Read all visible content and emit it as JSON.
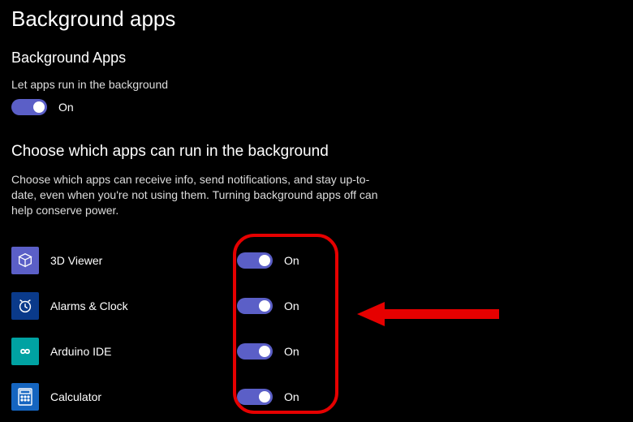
{
  "colors": {
    "accent": "#5b5fc7",
    "highlight": "#e60000"
  },
  "page": {
    "title": "Background apps"
  },
  "master": {
    "sectionTitle": "Background Apps",
    "desc": "Let apps run in the background",
    "state": "On"
  },
  "choose": {
    "title": "Choose which apps can run in the background",
    "desc": "Choose which apps can receive info, send notifications, and stay up-to-date, even when you're not using them. Turning background apps off can help conserve power."
  },
  "apps": [
    {
      "name": "3D Viewer",
      "state": "On",
      "iconClass": "ic-3d",
      "svg": "cube"
    },
    {
      "name": "Alarms & Clock",
      "state": "On",
      "iconClass": "ic-alarm",
      "svg": "clock"
    },
    {
      "name": "Arduino IDE",
      "state": "On",
      "iconClass": "ic-arduino",
      "svg": "infinity"
    },
    {
      "name": "Calculator",
      "state": "On",
      "iconClass": "ic-calc",
      "svg": "calc"
    }
  ]
}
